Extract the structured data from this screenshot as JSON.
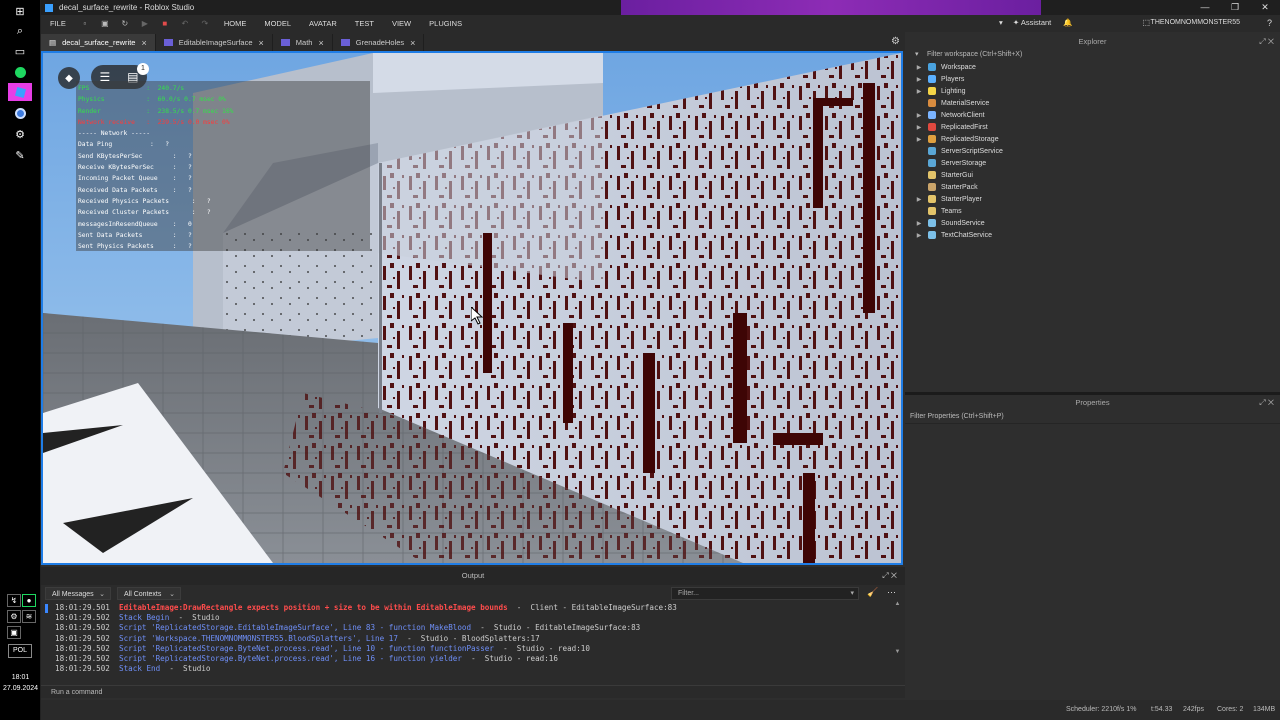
{
  "taskbar": {
    "icons": [
      "windows-start",
      "search",
      "task-view",
      "spotify",
      "roblox-studio",
      "browser",
      "steam",
      "app"
    ],
    "language": "POL",
    "time": "18:01",
    "date": "27.09.2024"
  },
  "window": {
    "title": "decal_surface_rewrite - Roblox Studio",
    "controls": [
      "—",
      "❐",
      "✕"
    ]
  },
  "menu": {
    "file": "FILE",
    "items": [
      "HOME",
      "MODEL",
      "AVATAR",
      "TEST",
      "VIEW",
      "PLUGINS"
    ],
    "assistant": "Assistant",
    "username": "THENOMNOMMONSTER55"
  },
  "tabs": [
    {
      "label": "decal_surface_rewrite"
    },
    {
      "label": "EditableImageSurface"
    },
    {
      "label": "Math"
    },
    {
      "label": "GrenadeHoles"
    }
  ],
  "viewport": {
    "badge": "1",
    "stats": [
      {
        "text": "FPS               :  240.7/s",
        "color": "g"
      },
      {
        "text": "Physics           :  60.0/s 0.7 msec 0%",
        "color": "g"
      },
      {
        "text": "Render            :  238.5/s 0.7 msec 16%",
        "color": "g"
      },
      {
        "text": "Network receive   :  239.5/s 0.0 msec 0%",
        "color": "r"
      },
      {
        "text": "----- Network -----",
        "color": "w"
      },
      {
        "text": "Data Ping          :   ?",
        "color": "w"
      },
      {
        "text": "Send KBytesPerSec        :   ?",
        "color": "w"
      },
      {
        "text": "Receive KBytesPerSec     :   ?",
        "color": "w"
      },
      {
        "text": "Incoming Packet Queue    :   ?",
        "color": "w"
      },
      {
        "text": "Received Data Packets    :   ?",
        "color": "w"
      },
      {
        "text": "Received Physics Packets      :   ?",
        "color": "w"
      },
      {
        "text": "Received Cluster Packets      :   ?",
        "color": "w"
      },
      {
        "text": "messagesInResendQueue    :   0",
        "color": "w"
      },
      {
        "text": "Sent Data Packets        :   ?",
        "color": "w"
      },
      {
        "text": "Sent Physics Packets     :   ?",
        "color": "w"
      }
    ]
  },
  "explorer": {
    "title": "Explorer",
    "filter": "Filter workspace (Ctrl+Shift+X)",
    "items": [
      {
        "label": "Workspace",
        "expandable": true,
        "color": "#4aa3df"
      },
      {
        "label": "Players",
        "expandable": true,
        "color": "#5bb0ff"
      },
      {
        "label": "Lighting",
        "expandable": true,
        "color": "#f5d547"
      },
      {
        "label": "MaterialService",
        "expandable": false,
        "color": "#d98c3f"
      },
      {
        "label": "NetworkClient",
        "expandable": true,
        "color": "#7bb4ff"
      },
      {
        "label": "ReplicatedFirst",
        "expandable": true,
        "color": "#e0493f"
      },
      {
        "label": "ReplicatedStorage",
        "expandable": true,
        "color": "#e0a03f"
      },
      {
        "label": "ServerScriptService",
        "expandable": false,
        "color": "#5aa7d6"
      },
      {
        "label": "ServerStorage",
        "expandable": false,
        "color": "#5aa7d6"
      },
      {
        "label": "StarterGui",
        "expandable": false,
        "color": "#e3c46a"
      },
      {
        "label": "StarterPack",
        "expandable": false,
        "color": "#caa46a"
      },
      {
        "label": "StarterPlayer",
        "expandable": true,
        "color": "#e3c46a"
      },
      {
        "label": "Teams",
        "expandable": false,
        "color": "#e3c46a"
      },
      {
        "label": "SoundService",
        "expandable": true,
        "color": "#7cc0e8"
      },
      {
        "label": "TextChatService",
        "expandable": true,
        "color": "#7cc0e8"
      }
    ]
  },
  "properties": {
    "title": "Properties",
    "filter": "Filter Properties (Ctrl+Shift+P)"
  },
  "output": {
    "title": "Output",
    "messages_filter": "All Messages",
    "contexts_filter": "All Contexts",
    "filter_placeholder": "Filter...",
    "lines": [
      {
        "ts": "18:01:29.501",
        "msg": "EditableImage:DrawRectangle expects position + size to be within EditableImage bounds",
        "src": "  -  Client - EditableImageSurface:83",
        "kind": "err"
      },
      {
        "ts": "18:01:29.502",
        "msg": "Stack Begin",
        "src": "  -  Studio",
        "kind": "info"
      },
      {
        "ts": "18:01:29.502",
        "msg": "Script 'ReplicatedStorage.EditableImageSurface', Line 83 - function MakeBlood",
        "src": "  -  Studio - EditableImageSurface:83",
        "kind": "info"
      },
      {
        "ts": "18:01:29.502",
        "msg": "Script 'Workspace.THENOMNOMMONSTER55.BloodSplatters', Line 17",
        "src": "  -  Studio - BloodSplatters:17",
        "kind": "info"
      },
      {
        "ts": "18:01:29.502",
        "msg": "Script 'ReplicatedStorage.ByteNet.process.read', Line 10 - function functionPasser",
        "src": "  -  Studio - read:10",
        "kind": "info"
      },
      {
        "ts": "18:01:29.502",
        "msg": "Script 'ReplicatedStorage.ByteNet.process.read', Line 16 - function yielder",
        "src": "  -  Studio - read:16",
        "kind": "info"
      },
      {
        "ts": "18:01:29.502",
        "msg": "Stack End",
        "src": "  -  Studio",
        "kind": "info"
      }
    ],
    "command_placeholder": "Run a command"
  },
  "status": {
    "scheduler": "Scheduler: 2210f/s 1%",
    "time": "t:54.33",
    "fps": "242fps",
    "cores": "Cores: 2",
    "memory": "134MB"
  }
}
